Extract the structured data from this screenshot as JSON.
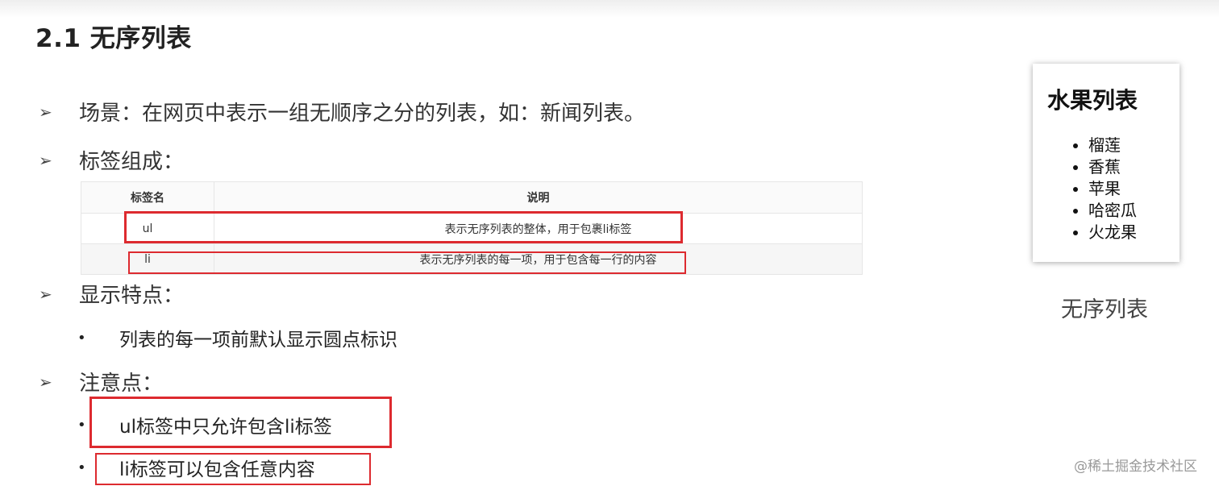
{
  "heading": "2.1 无序列表",
  "bullets": [
    {
      "marker": "➢",
      "text": "场景：在网页中表示一组无顺序之分的列表，如：新闻列表。"
    },
    {
      "marker": "➢",
      "text": "标签组成："
    },
    {
      "marker": "➢",
      "text": "显示特点："
    },
    {
      "marker": "➢",
      "text": "注意点："
    }
  ],
  "table": {
    "headers": [
      "标签名",
      "说明"
    ],
    "rows": [
      {
        "name": "ul",
        "desc": "表示无序列表的整体，用于包裹li标签"
      },
      {
        "name": "li",
        "desc": "表示无序列表的每一项，用于包含每一行的内容"
      }
    ]
  },
  "display_points": [
    {
      "marker": "•",
      "text": "列表的每一项前默认显示圆点标识"
    }
  ],
  "notes": [
    {
      "marker": "•",
      "text": "ul标签中只允许包含li标签"
    },
    {
      "marker": "•",
      "text": "li标签可以包含任意内容"
    }
  ],
  "example": {
    "title": "水果列表",
    "items": [
      "榴莲",
      "香蕉",
      "苹果",
      "哈密瓜",
      "火龙果"
    ],
    "caption": "无序列表"
  },
  "watermark": "@稀土掘金技术社区",
  "colors": {
    "highlight": "#dd2a2f"
  }
}
